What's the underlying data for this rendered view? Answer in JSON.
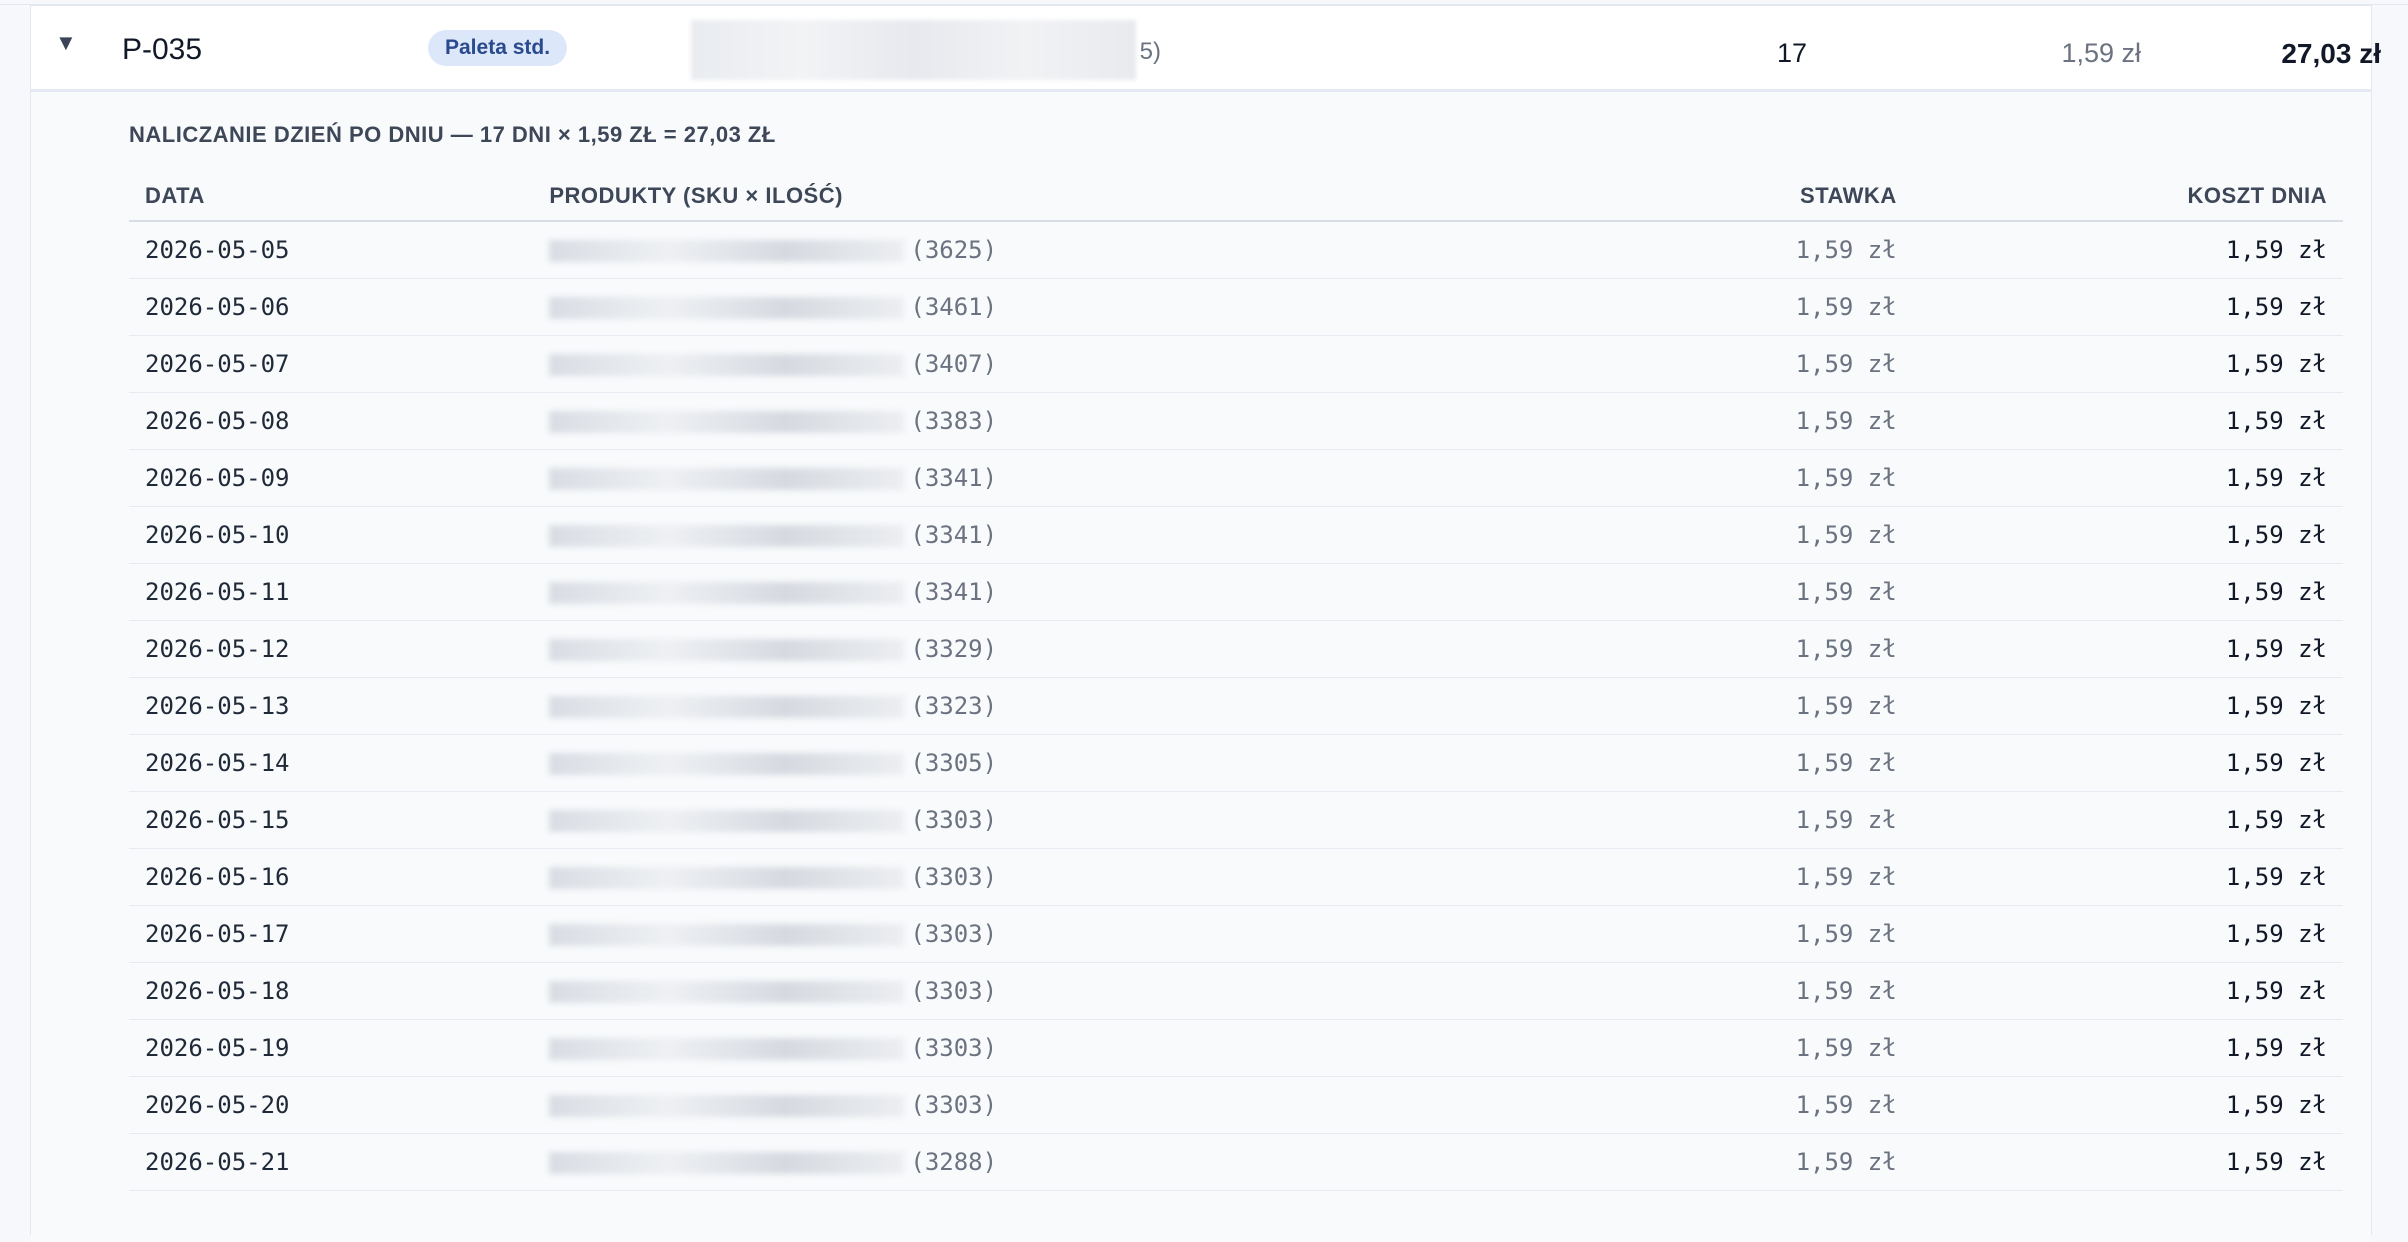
{
  "pallet": {
    "toggle_icon": "▼",
    "id": "P-035",
    "type_badge": "Paleta std.",
    "products_tail": "5)",
    "days": "17",
    "rate": "1,59 zł",
    "total": "27,03 zł"
  },
  "detail": {
    "title": "NALICZANIE DZIEŃ PO DNIU — 17 DNI × 1,59 ZŁ = 27,03 ZŁ",
    "headers": {
      "date": "DATA",
      "products": "PRODUKTY (SKU × ILOŚĆ)",
      "rate": "STAWKA",
      "cost": "KOSZT DNIA"
    },
    "rows": [
      {
        "date": "2026-05-05",
        "products": "(3625)",
        "rate": "1,59 zł",
        "cost": "1,59 zł"
      },
      {
        "date": "2026-05-06",
        "products": "(3461)",
        "rate": "1,59 zł",
        "cost": "1,59 zł"
      },
      {
        "date": "2026-05-07",
        "products": "(3407)",
        "rate": "1,59 zł",
        "cost": "1,59 zł"
      },
      {
        "date": "2026-05-08",
        "products": "(3383)",
        "rate": "1,59 zł",
        "cost": "1,59 zł"
      },
      {
        "date": "2026-05-09",
        "products": "(3341)",
        "rate": "1,59 zł",
        "cost": "1,59 zł"
      },
      {
        "date": "2026-05-10",
        "products": "(3341)",
        "rate": "1,59 zł",
        "cost": "1,59 zł"
      },
      {
        "date": "2026-05-11",
        "products": "(3341)",
        "rate": "1,59 zł",
        "cost": "1,59 zł"
      },
      {
        "date": "2026-05-12",
        "products": "(3329)",
        "rate": "1,59 zł",
        "cost": "1,59 zł"
      },
      {
        "date": "2026-05-13",
        "products": "(3323)",
        "rate": "1,59 zł",
        "cost": "1,59 zł"
      },
      {
        "date": "2026-05-14",
        "products": "(3305)",
        "rate": "1,59 zł",
        "cost": "1,59 zł"
      },
      {
        "date": "2026-05-15",
        "products": "(3303)",
        "rate": "1,59 zł",
        "cost": "1,59 zł"
      },
      {
        "date": "2026-05-16",
        "products": "(3303)",
        "rate": "1,59 zł",
        "cost": "1,59 zł"
      },
      {
        "date": "2026-05-17",
        "products": "(3303)",
        "rate": "1,59 zł",
        "cost": "1,59 zł"
      },
      {
        "date": "2026-05-18",
        "products": "(3303)",
        "rate": "1,59 zł",
        "cost": "1,59 zł"
      },
      {
        "date": "2026-05-19",
        "products": "(3303)",
        "rate": "1,59 zł",
        "cost": "1,59 zł"
      },
      {
        "date": "2026-05-20",
        "products": "(3303)",
        "rate": "1,59 zł",
        "cost": "1,59 zł"
      },
      {
        "date": "2026-05-21",
        "products": "(3288)",
        "rate": "1,59 zł",
        "cost": "1,59 zł"
      }
    ]
  }
}
